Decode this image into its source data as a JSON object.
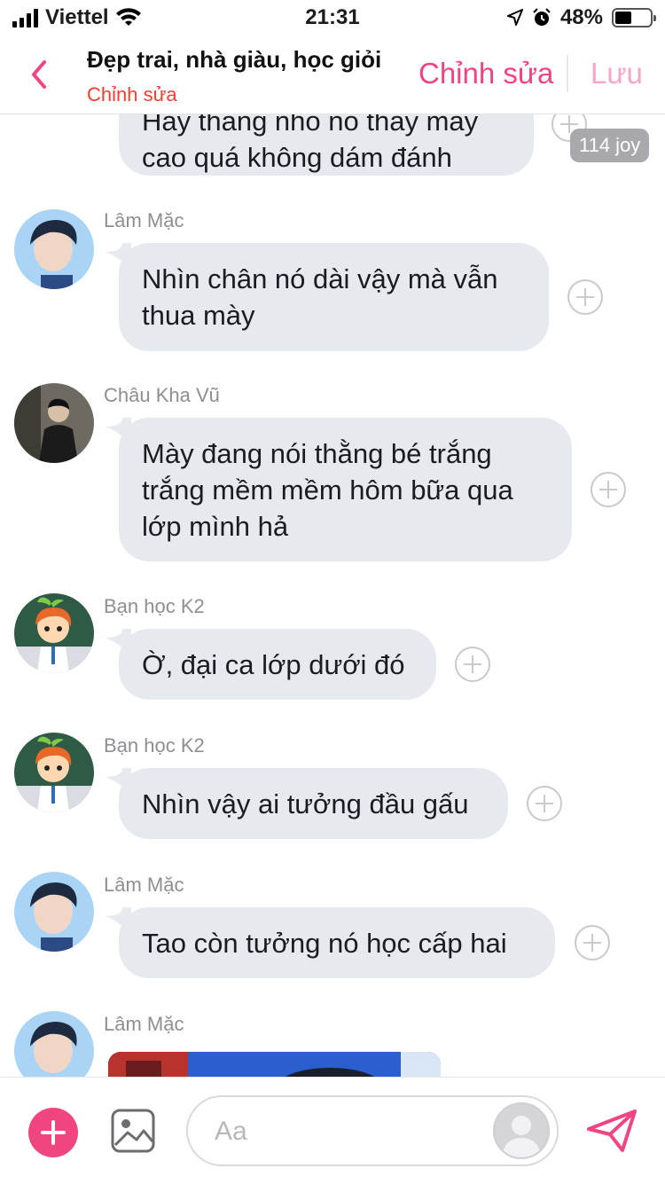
{
  "status_bar": {
    "carrier": "Viettel",
    "time": "21:31",
    "battery_percent": "48%",
    "battery_level": 0.48
  },
  "header": {
    "title": "Đẹp trai, nhà giàu, học giỏi",
    "subtitle": "Chỉnh sửa",
    "edit_label": "Chỉnh sửa",
    "save_label": "Lưu"
  },
  "messages": [
    {
      "sender": "",
      "lines": [
        "Hay thằng nhỏ nó thấy mày",
        "cao quá không dám đánh"
      ],
      "reaction": "114 joy"
    },
    {
      "sender": "Lâm Mặc",
      "lines": [
        "Nhìn chân nó dài vậy mà vẫn",
        "thua mày"
      ]
    },
    {
      "sender": "Châu Kha Vũ",
      "lines": [
        "Mày đang nói thằng bé trắng",
        "trắng mềm mềm hôm bữa qua",
        "lớp mình hả"
      ]
    },
    {
      "sender": "Bạn học K2",
      "lines": [
        "Ờ, đại ca lớp dưới đó"
      ]
    },
    {
      "sender": "Bạn học K2",
      "lines": [
        "Nhìn vậy ai tưởng đầu gấu"
      ]
    },
    {
      "sender": "Lâm Mặc",
      "lines": [
        "Tao còn tưởng nó học cấp hai"
      ]
    },
    {
      "sender": "Lâm Mặc",
      "lines": []
    }
  ],
  "composer": {
    "placeholder": "Aa"
  },
  "colors": {
    "accent": "#f0457f",
    "subtitle": "#ff3b30",
    "bubble": "#e6e9ee"
  }
}
